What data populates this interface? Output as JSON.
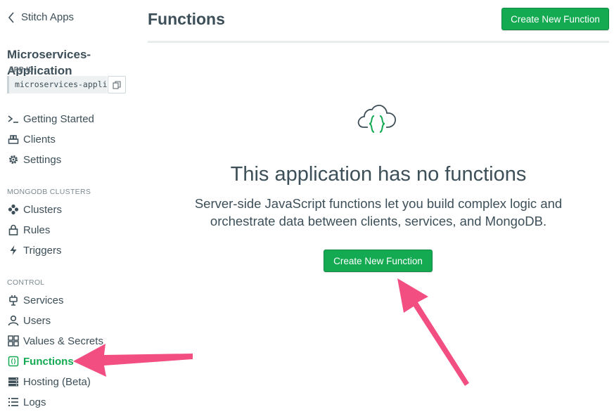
{
  "sidebar": {
    "back_label": "Stitch Apps",
    "app_title": "Microservices-Application",
    "app_id_label": "APP ID",
    "app_id_value": "microservices-application",
    "top_items": [
      {
        "label": "Getting Started",
        "icon": "terminal-icon"
      },
      {
        "label": "Clients",
        "icon": "clients-icon"
      },
      {
        "label": "Settings",
        "icon": "gear-icon"
      }
    ],
    "sections": [
      {
        "title": "MONGODB CLUSTERS",
        "items": [
          {
            "label": "Clusters",
            "icon": "cluster-icon"
          },
          {
            "label": "Rules",
            "icon": "lock-icon"
          },
          {
            "label": "Triggers",
            "icon": "lightning-icon"
          }
        ]
      },
      {
        "title": "CONTROL",
        "items": [
          {
            "label": "Services",
            "icon": "plug-icon"
          },
          {
            "label": "Users",
            "icon": "user-icon"
          },
          {
            "label": "Values & Secrets",
            "icon": "grid-icon"
          },
          {
            "label": "Functions",
            "icon": "functions-icon",
            "active": true
          },
          {
            "label": "Hosting (Beta)",
            "icon": "server-icon"
          },
          {
            "label": "Logs",
            "icon": "list-icon"
          }
        ]
      }
    ]
  },
  "main": {
    "title": "Functions",
    "header_button": "Create New Function",
    "empty_state": {
      "icon": "cloud-braces-icon",
      "title": "This application has no functions",
      "description": "Server-side JavaScript functions let you build complex logic and orchestrate data between clients, services, and MongoDB.",
      "button": "Create New Function"
    }
  },
  "colors": {
    "accent_green": "#13aa52",
    "text": "#3d4f58",
    "annotation_arrow": "#f2457a"
  }
}
